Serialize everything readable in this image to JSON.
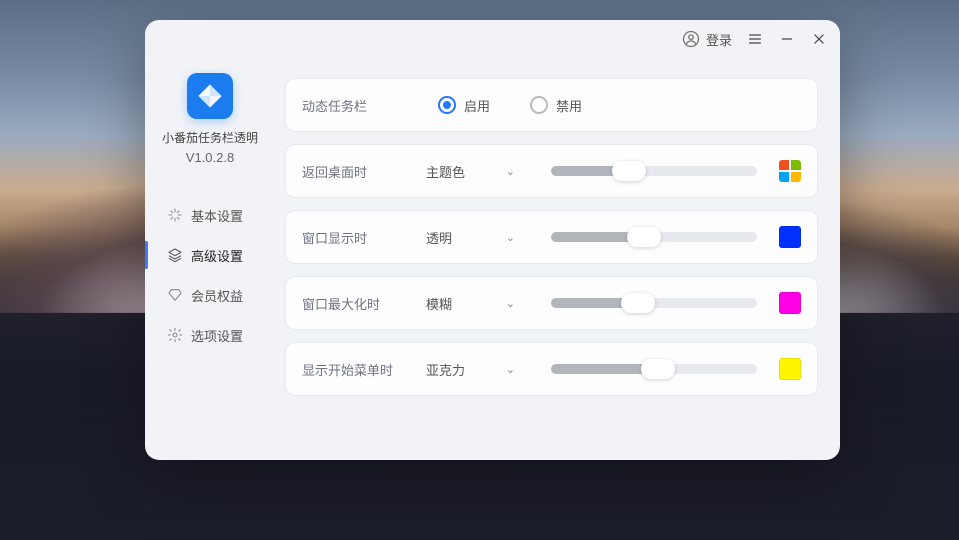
{
  "titlebar": {
    "login": "登录"
  },
  "app": {
    "name": "小番茄任务栏透明",
    "version": "V1.0.2.8"
  },
  "nav": {
    "items": [
      {
        "label": "基本设置",
        "icon": "sparkle-icon",
        "active": false
      },
      {
        "label": "高级设置",
        "icon": "layers-icon",
        "active": true
      },
      {
        "label": "会员权益",
        "icon": "diamond-icon",
        "active": false
      },
      {
        "label": "选项设置",
        "icon": "gear-icon",
        "active": false
      }
    ]
  },
  "settings": {
    "dynamic_taskbar": {
      "label": "动态任务栏",
      "enable": "启用",
      "disable": "禁用",
      "value": "enable"
    },
    "rows": [
      {
        "label": "返回桌面时",
        "dropdown": "主题色",
        "slider": 38,
        "swatch_type": "win",
        "swatch_color": ""
      },
      {
        "label": "窗口显示时",
        "dropdown": "透明",
        "slider": 45,
        "swatch_type": "solid",
        "swatch_color": "#0030ff"
      },
      {
        "label": "窗口最大化时",
        "dropdown": "模糊",
        "slider": 42,
        "swatch_type": "solid",
        "swatch_color": "#ff00e6"
      },
      {
        "label": "显示开始菜单时",
        "dropdown": "亚克力",
        "slider": 52,
        "swatch_type": "solid",
        "swatch_color": "#fff500"
      }
    ]
  }
}
